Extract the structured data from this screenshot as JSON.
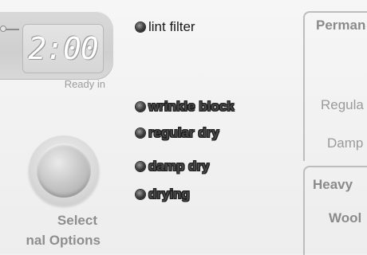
{
  "display": {
    "time": "2:00",
    "ready_label": "Ready in"
  },
  "knob": {
    "label_line1": "Select",
    "label_line2": "nal Options"
  },
  "indicators": [
    {
      "label": "lint filter"
    },
    {
      "label": "wrinkle block"
    },
    {
      "label": "regular dry"
    },
    {
      "label": "damp dry"
    },
    {
      "label": "drying"
    }
  ],
  "right_panel_top": {
    "heading": "Perman",
    "items": [
      "Regula",
      "Damp"
    ]
  },
  "right_panel_bottom": {
    "items": [
      "Heavy",
      "Wool"
    ]
  }
}
